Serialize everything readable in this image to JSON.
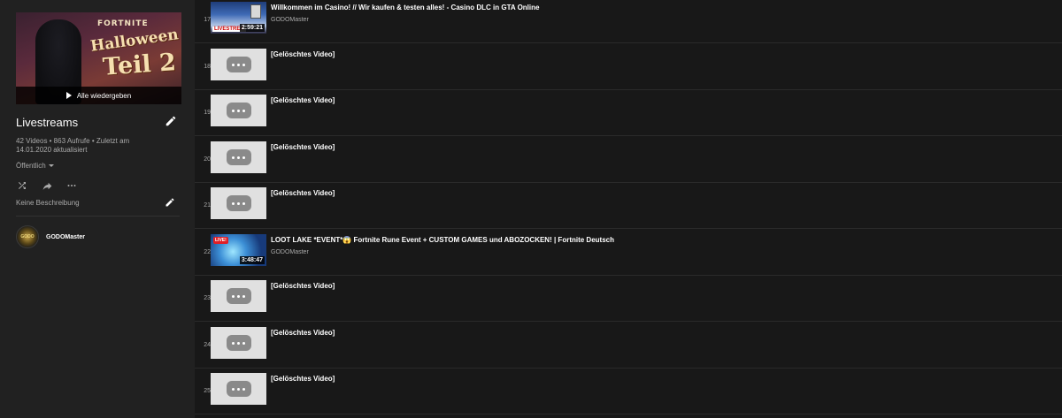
{
  "sidebar": {
    "hero": {
      "brand": "FORTNITE",
      "line1": "Halloween",
      "line2": "Teil 2",
      "play_all_label": "Alle wiedergeben"
    },
    "title": "Livestreams",
    "stats": "42 Videos • 863 Aufrufe • Zuletzt am 14.01.2020 aktualisiert",
    "privacy": "Öffentlich",
    "description": "Keine Beschreibung",
    "owner": {
      "name": "GODOMaster",
      "avatar_text": "GODO"
    },
    "icons": {
      "edit": "pencil-icon",
      "shuffle": "shuffle-icon",
      "share": "share-icon",
      "more": "more-icon"
    }
  },
  "videos": [
    {
      "index": "17",
      "title": "Willkommen im Casino! // Wir kaufen & testen alles! - Casino DLC in GTA Online",
      "channel": "GODOMaster",
      "duration": "2:59:21",
      "badge": "LIVESTREA",
      "thumb": "gta"
    },
    {
      "index": "18",
      "title": "[Gelöschtes Video]",
      "thumb": "deleted"
    },
    {
      "index": "19",
      "title": "[Gelöschtes Video]",
      "thumb": "deleted"
    },
    {
      "index": "20",
      "title": "[Gelöschtes Video]",
      "thumb": "deleted"
    },
    {
      "index": "21",
      "title": "[Gelöschtes Video]",
      "thumb": "deleted"
    },
    {
      "index": "22",
      "title": "LOOT LAKE *EVENT*😱 Fortnite Rune Event + CUSTOM GAMES und ABOZOCKEN! | Fortnite Deutsch",
      "channel": "GODOMaster",
      "duration": "3:48:47",
      "live_tag": "LIVE!",
      "thumb": "fortnite"
    },
    {
      "index": "23",
      "title": "[Gelöschtes Video]",
      "thumb": "deleted"
    },
    {
      "index": "24",
      "title": "[Gelöschtes Video]",
      "thumb": "deleted"
    },
    {
      "index": "25",
      "title": "[Gelöschtes Video]",
      "thumb": "deleted"
    }
  ],
  "colors": {
    "page_bg": "#181818",
    "sidebar_bg": "#212121",
    "text_primary": "#ffffff",
    "text_secondary": "#aaaaaa"
  }
}
